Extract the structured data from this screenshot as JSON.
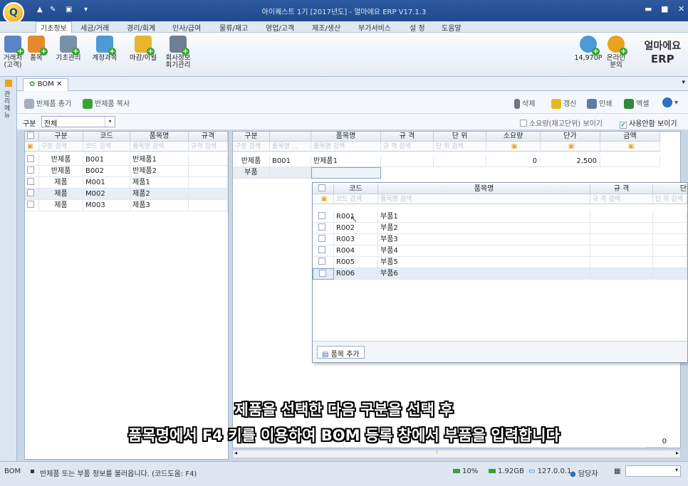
{
  "window": {
    "title": "아이퀘스트 1기 [2017년도] - 얼마에요 ERP V17.1.3",
    "logo": "Q"
  },
  "menu": [
    "기초정보",
    "세금/거래",
    "경리/회계",
    "인사/급여",
    "물류/재고",
    "영업/고객",
    "제조/생산",
    "부가서비스",
    "설 정",
    "도움말"
  ],
  "ribbon": [
    {
      "label": "거래처(고객)",
      "color": "#5a86c5"
    },
    {
      "label": "품목",
      "color": "#e58a2c"
    },
    {
      "label": "기초관리",
      "color": "#7a8fa8"
    },
    {
      "label": "계정과목",
      "color": "#4c9ad6"
    },
    {
      "label": "마감/이월",
      "color": "#e8b52e"
    },
    {
      "label": "회사정보 회기관리",
      "color": "#6f7f92"
    }
  ],
  "right_tools": {
    "points": "14,970P",
    "online": "온라인 분의",
    "brand1": "얼마에요",
    "brand2": "ERP"
  },
  "doc_tab": "BOM",
  "left_strip": "관리메뉴",
  "toolbar": {
    "load": "반제품 총기",
    "copy": "반제품 복사",
    "delete": "삭제",
    "refresh": "갱신",
    "print": "인쇄",
    "excel": "엑셀"
  },
  "filter": {
    "label": "구분",
    "value": "전체",
    "opt1": "소요량(재고단위) 보이기",
    "opt2": "사용안함 보이기"
  },
  "left_grid": {
    "headers": [
      "구분",
      "코드",
      "품목명",
      "규격"
    ],
    "filters": [
      "구분 검색",
      "코드 검색",
      "품목명 검색",
      "규격 검색"
    ],
    "rows": [
      [
        "반제품",
        "B001",
        "반제품1",
        ""
      ],
      [
        "반제품",
        "B002",
        "반제품2",
        ""
      ],
      [
        "제품",
        "M001",
        "제품1",
        ""
      ],
      [
        "제품",
        "M002",
        "제품2",
        ""
      ],
      [
        "제품",
        "M003",
        "제품3",
        ""
      ]
    ]
  },
  "right_grid": {
    "headers": [
      "구분",
      "",
      "품목명",
      "규 격",
      "단 위",
      "소요량",
      "단가",
      "금액"
    ],
    "filters": [
      "구분 검색",
      "품목명 ...",
      "품목명 검색",
      "규 격 검색",
      "단 위 검색"
    ],
    "rows": [
      [
        "반제품",
        "B001",
        "반제품1",
        "",
        "",
        "0",
        "2,500",
        ""
      ],
      [
        "부품",
        "",
        "",
        "",
        "",
        "",
        "",
        ""
      ]
    ]
  },
  "popup": {
    "headers": [
      "코드",
      "품목명",
      "규 격",
      "단"
    ],
    "filters": [
      "코드 검색",
      "품목명 검색",
      "규 격 검색",
      "단 위 검색"
    ],
    "rows": [
      [
        "R001",
        "부품1"
      ],
      [
        "R002",
        "부품2"
      ],
      [
        "R003",
        "부품3"
      ],
      [
        "R004",
        "부품4"
      ],
      [
        "R005",
        "부품5"
      ],
      [
        "R006",
        "부품6"
      ]
    ],
    "add_button": "품목 추가"
  },
  "subtitle": {
    "line1": "제품을 선택한 다음 구분을 선택 후",
    "line2": "품목명에서 F4 키를 이용하여 BOM 등록 창에서 부품을 입력합니다"
  },
  "footer_value": "0",
  "status": {
    "module": "BOM",
    "message": "반제품 또는 부품 정보를 불러옵니다. (코드도움: F4)",
    "cpu": "10%",
    "mem": "1.92GB",
    "ip": "127.0.0.1",
    "user": "담당자"
  }
}
